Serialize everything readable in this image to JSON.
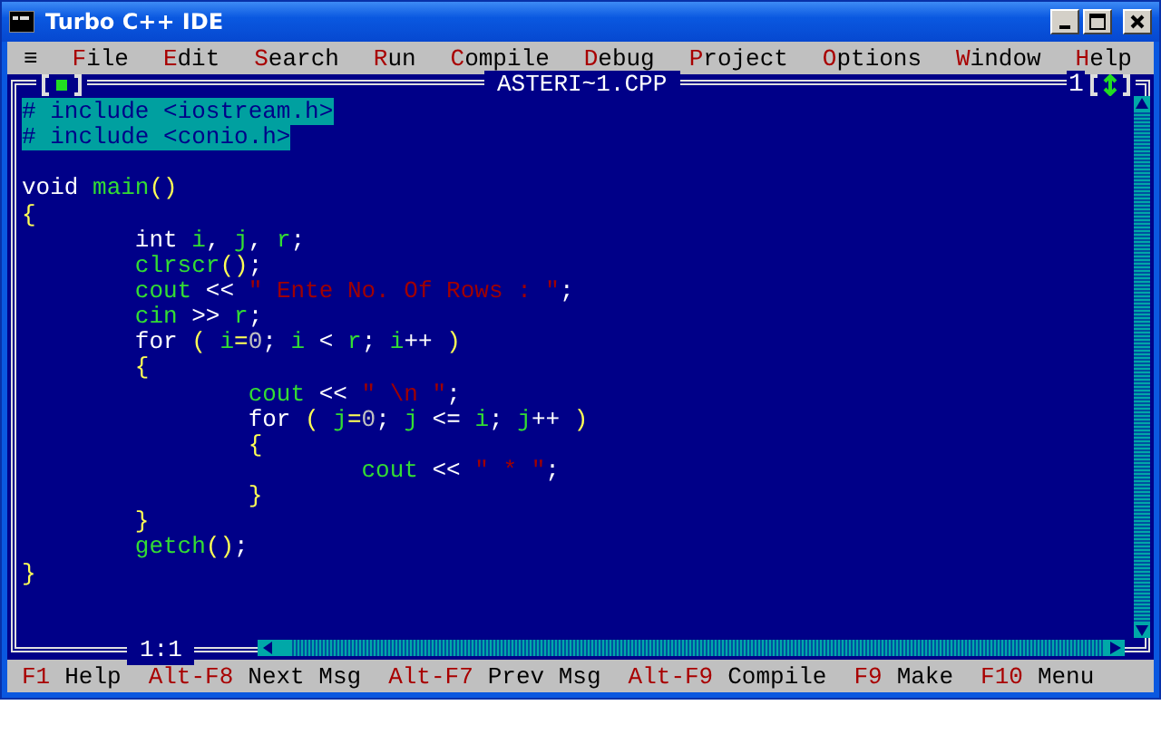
{
  "window": {
    "title": "Turbo C++ IDE"
  },
  "menu": {
    "system": "≡",
    "items": [
      {
        "label": "File"
      },
      {
        "label": "Edit"
      },
      {
        "label": "Search"
      },
      {
        "label": "Run"
      },
      {
        "label": "Compile"
      },
      {
        "label": "Debug"
      },
      {
        "label": "Project"
      },
      {
        "label": "Options"
      },
      {
        "label": "Window"
      },
      {
        "label": "Help"
      }
    ]
  },
  "editor": {
    "title": "ASTERI~1.CPP",
    "window_number": "1",
    "position": "1:1",
    "lines": [
      {
        "kind": "code",
        "selected": true,
        "tokens": [
          {
            "text": "# include <iostream.h>",
            "kind": "pp"
          }
        ]
      },
      {
        "kind": "code",
        "selected": true,
        "tokens": [
          {
            "text": "# include <conio.h>",
            "kind": "pp"
          }
        ]
      },
      {
        "kind": "blank"
      },
      {
        "kind": "code",
        "selected": false,
        "tokens": [
          {
            "text": "void ",
            "kind": "kw"
          },
          {
            "text": "main",
            "kind": "id"
          },
          {
            "text": "()",
            "kind": "br"
          }
        ]
      },
      {
        "kind": "code",
        "selected": false,
        "tokens": [
          {
            "text": "{",
            "kind": "br"
          }
        ],
        "children": [
          {
            "kind": "code",
            "selected": false,
            "tokens": [
              {
                "text": "int ",
                "kind": "kw"
              },
              {
                "text": "i",
                "kind": "id"
              },
              {
                "text": ", ",
                "kind": "op"
              },
              {
                "text": "j",
                "kind": "id"
              },
              {
                "text": ", ",
                "kind": "op"
              },
              {
                "text": "r",
                "kind": "id"
              },
              {
                "text": ";",
                "kind": "op"
              }
            ]
          },
          {
            "kind": "code",
            "selected": false,
            "tokens": [
              {
                "text": "clrscr",
                "kind": "id"
              },
              {
                "text": "()",
                "kind": "br"
              },
              {
                "text": ";",
                "kind": "op"
              }
            ]
          },
          {
            "kind": "code",
            "selected": false,
            "tokens": [
              {
                "text": "cout",
                "kind": "id"
              },
              {
                "text": " << ",
                "kind": "op"
              },
              {
                "text": "\" Ente No. Of Rows : \"",
                "kind": "str"
              },
              {
                "text": ";",
                "kind": "op"
              }
            ]
          },
          {
            "kind": "code",
            "selected": false,
            "tokens": [
              {
                "text": "cin",
                "kind": "id"
              },
              {
                "text": " >> ",
                "kind": "op"
              },
              {
                "text": "r",
                "kind": "id"
              },
              {
                "text": ";",
                "kind": "op"
              }
            ]
          },
          {
            "kind": "code",
            "selected": false,
            "tokens": [
              {
                "text": "for ",
                "kind": "kw"
              },
              {
                "text": "( ",
                "kind": "br"
              },
              {
                "text": "i",
                "kind": "id"
              },
              {
                "text": "=",
                "kind": "br"
              },
              {
                "text": "0",
                "kind": "num"
              },
              {
                "text": "; ",
                "kind": "op"
              },
              {
                "text": "i",
                "kind": "id"
              },
              {
                "text": " < ",
                "kind": "op"
              },
              {
                "text": "r",
                "kind": "id"
              },
              {
                "text": "; ",
                "kind": "op"
              },
              {
                "text": "i",
                "kind": "id"
              },
              {
                "text": "++",
                "kind": "op"
              },
              {
                "text": " )",
                "kind": "br"
              }
            ]
          },
          {
            "kind": "code",
            "selected": false,
            "tokens": [
              {
                "text": "{",
                "kind": "br"
              }
            ],
            "children": [
              {
                "kind": "code",
                "selected": false,
                "tokens": [
                  {
                    "text": "cout",
                    "kind": "id"
                  },
                  {
                    "text": " << ",
                    "kind": "op"
                  },
                  {
                    "text": "\" \\n \"",
                    "kind": "str"
                  },
                  {
                    "text": ";",
                    "kind": "op"
                  }
                ]
              },
              {
                "kind": "code",
                "selected": false,
                "tokens": [
                  {
                    "text": "for ",
                    "kind": "kw"
                  },
                  {
                    "text": "( ",
                    "kind": "br"
                  },
                  {
                    "text": "j",
                    "kind": "id"
                  },
                  {
                    "text": "=",
                    "kind": "br"
                  },
                  {
                    "text": "0",
                    "kind": "num"
                  },
                  {
                    "text": "; ",
                    "kind": "op"
                  },
                  {
                    "text": "j",
                    "kind": "id"
                  },
                  {
                    "text": " <= ",
                    "kind": "op"
                  },
                  {
                    "text": "i",
                    "kind": "id"
                  },
                  {
                    "text": "; ",
                    "kind": "op"
                  },
                  {
                    "text": "j",
                    "kind": "id"
                  },
                  {
                    "text": "++",
                    "kind": "op"
                  },
                  {
                    "text": " )",
                    "kind": "br"
                  }
                ]
              },
              {
                "kind": "code",
                "selected": false,
                "tokens": [
                  {
                    "text": "{",
                    "kind": "br"
                  }
                ],
                "children": [
                  {
                    "kind": "code",
                    "selected": false,
                    "tokens": [
                      {
                        "text": "cout",
                        "kind": "id"
                      },
                      {
                        "text": " << ",
                        "kind": "op"
                      },
                      {
                        "text": "\" * \"",
                        "kind": "str"
                      },
                      {
                        "text": ";",
                        "kind": "op"
                      }
                    ]
                  }
                ]
              },
              {
                "kind": "code",
                "selected": false,
                "tokens": [
                  {
                    "text": "}",
                    "kind": "br"
                  }
                ]
              }
            ]
          },
          {
            "kind": "code",
            "selected": false,
            "tokens": [
              {
                "text": "}",
                "kind": "br"
              }
            ]
          },
          {
            "kind": "code",
            "selected": false,
            "tokens": [
              {
                "text": "getch",
                "kind": "id"
              },
              {
                "text": "()",
                "kind": "br"
              },
              {
                "text": ";",
                "kind": "op"
              }
            ]
          }
        ]
      },
      {
        "kind": "code",
        "selected": false,
        "tokens": [
          {
            "text": "}",
            "kind": "br"
          }
        ]
      }
    ]
  },
  "status_bar": [
    {
      "key": "F1",
      "label": "Help"
    },
    {
      "key": "Alt-F8",
      "label": "Next Msg"
    },
    {
      "key": "Alt-F7",
      "label": "Prev Msg"
    },
    {
      "key": "Alt-F9",
      "label": "Compile"
    },
    {
      "key": "F9",
      "label": "Make"
    },
    {
      "key": "F10",
      "label": "Menu"
    }
  ]
}
